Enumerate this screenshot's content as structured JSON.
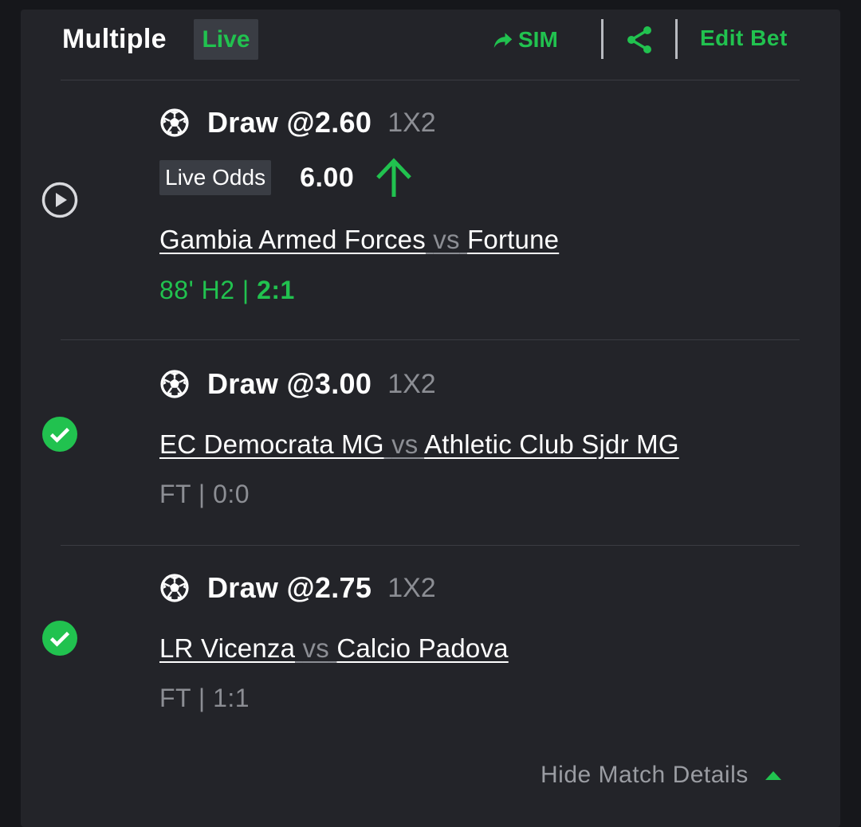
{
  "header": {
    "title": "Multiple",
    "live_badge": "Live",
    "sim_label": "SIM",
    "edit_label": "Edit Bet",
    "sim_icon": "share-arrow-icon",
    "share_icon": "share-icon"
  },
  "legs": [
    {
      "status": "live",
      "status_icon": "play-icon",
      "sport_icon": "soccer-ball-icon",
      "selection": "Draw @2.60",
      "market": "1X2",
      "live_odds_label": "Live Odds",
      "live_odds_value": "6.00",
      "live_odds_trend": "up",
      "home": "Gambia Armed Forces",
      "vs": "vs",
      "away": "Fortune",
      "time_status": "88' H2 | ",
      "score": "2:1"
    },
    {
      "status": "won",
      "status_icon": "check-circle-icon",
      "sport_icon": "soccer-ball-icon",
      "selection": "Draw @3.00",
      "market": "1X2",
      "home": "EC Democrata MG",
      "vs": "vs",
      "away": "Athletic Club Sjdr MG",
      "result": "FT | 0:0"
    },
    {
      "status": "won",
      "status_icon": "check-circle-icon",
      "sport_icon": "soccer-ball-icon",
      "selection": "Draw @2.75",
      "market": "1X2",
      "home": "LR Vicenza",
      "vs": "vs",
      "away": "Calcio Padova",
      "result": "FT | 1:1"
    }
  ],
  "footer": {
    "hide_details_label": "Hide Match Details",
    "hide_details_icon": "caret-up-icon"
  },
  "colors": {
    "accent_green": "#21c24f",
    "card_background": "#232429",
    "page_background": "#16171b",
    "muted_text": "#8c8e94"
  }
}
